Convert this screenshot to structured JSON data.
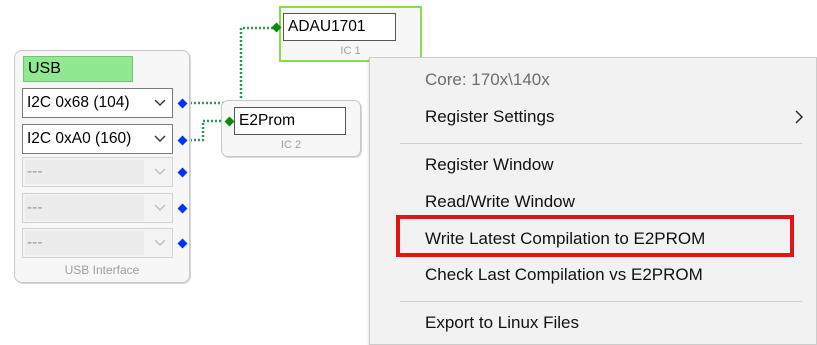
{
  "usb_block": {
    "name": "USB",
    "caption": "USB Interface",
    "channels": [
      {
        "label": "I2C 0x68 (104)",
        "enabled": true,
        "connected": true
      },
      {
        "label": "I2C 0xA0 (160)",
        "enabled": true,
        "connected": true
      },
      {
        "label": "---",
        "enabled": false,
        "connected": false
      },
      {
        "label": "---",
        "enabled": false,
        "connected": false
      },
      {
        "label": "---",
        "enabled": false,
        "connected": false
      }
    ]
  },
  "ic1": {
    "name": "ADAU1701",
    "caption": "IC 1"
  },
  "ic2": {
    "name": "E2Prom",
    "caption": "IC 2"
  },
  "context_menu": {
    "info": "Core: 170x\\140x",
    "register_settings": "Register Settings",
    "register_window": "Register Window",
    "read_write_window": "Read/Write Window",
    "write_latest": "Write Latest Compilation to E2PROM",
    "check_last": "Check Last Compilation vs E2PROM",
    "export_linux": "Export to Linux Files"
  },
  "colors": {
    "usb_name_bg": "#90e890",
    "ic1_border": "#88dd44",
    "wire": "#2a9a55",
    "pin_blue": "#0033ff",
    "highlight": "#e11515"
  }
}
